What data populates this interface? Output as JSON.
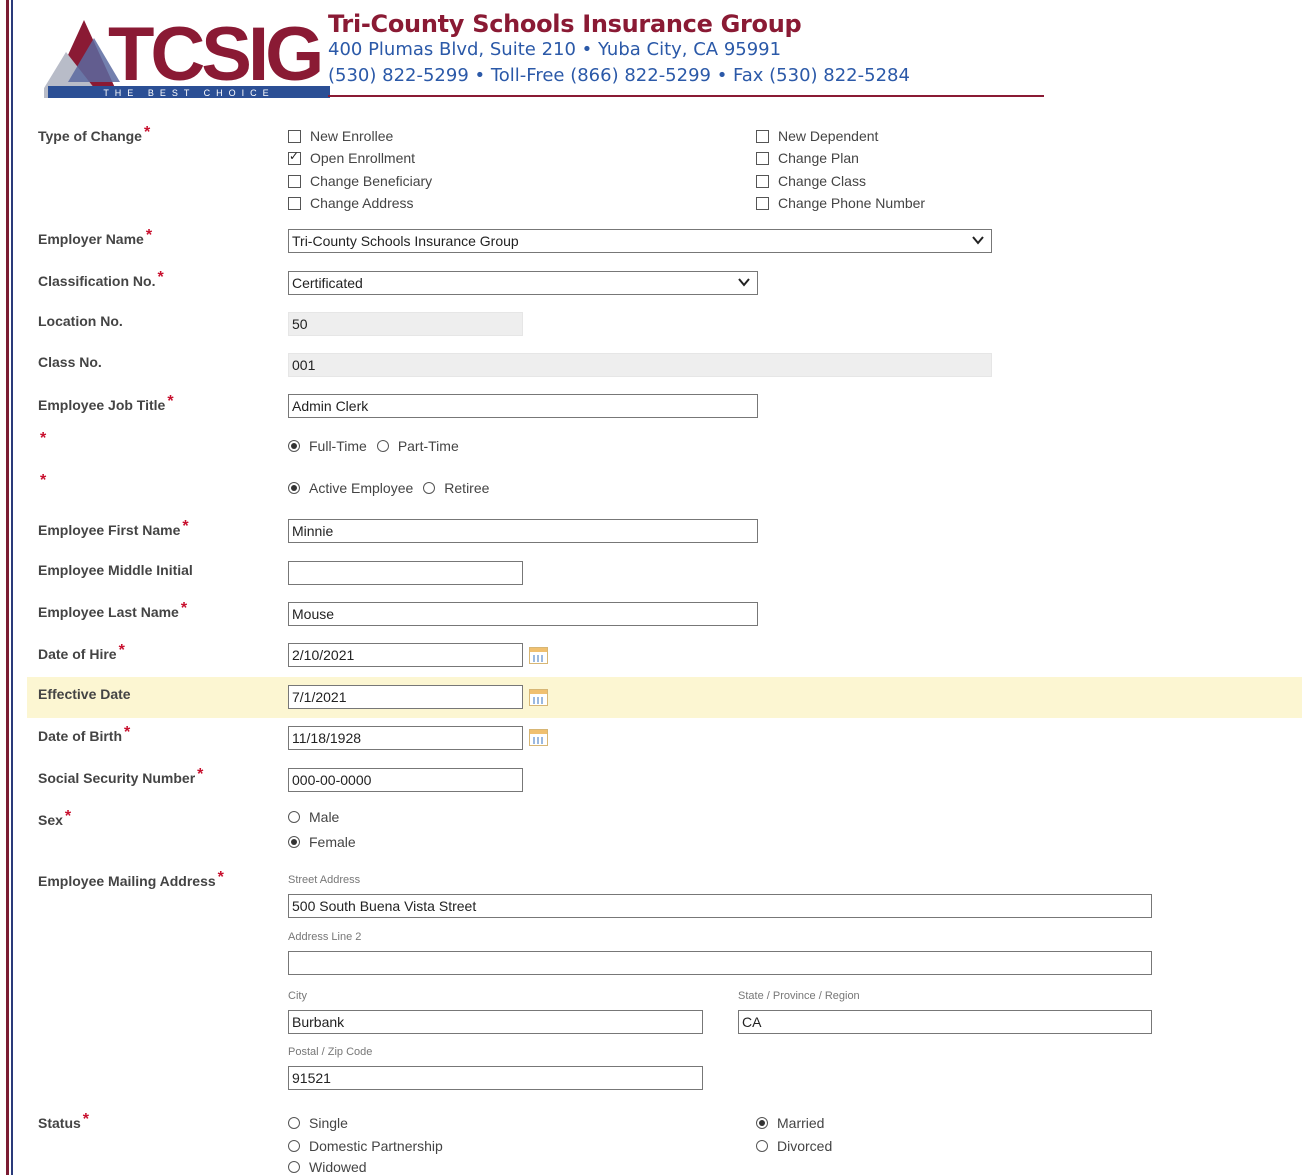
{
  "header": {
    "logo_text": "TCSIG",
    "logo_tagline": "THE BEST CHOICE",
    "org_name": "Tri-County Schools Insurance Group",
    "address": "400 Plumas Blvd, Suite 210  •  Yuba City, CA 95991",
    "phones": "(530) 822-5299  •  Toll-Free (866) 822-5299  •  Fax (530) 822-5284"
  },
  "required_mark": "*",
  "type_of_change": {
    "label": "Type of Change",
    "options": [
      {
        "label": "New Enrollee",
        "checked": false
      },
      {
        "label": "Open Enrollment",
        "checked": true
      },
      {
        "label": "Change Beneficiary",
        "checked": false
      },
      {
        "label": "Change Address",
        "checked": false
      },
      {
        "label": "New Dependent",
        "checked": false
      },
      {
        "label": "Change Plan",
        "checked": false
      },
      {
        "label": "Change Class",
        "checked": false
      },
      {
        "label": "Change Phone Number",
        "checked": false
      }
    ]
  },
  "employer_name": {
    "label": "Employer Name",
    "value": "Tri-County Schools Insurance Group"
  },
  "classification": {
    "label": "Classification No.",
    "value": "Certificated"
  },
  "location": {
    "label": "Location No.",
    "value": "50"
  },
  "class_no": {
    "label": "Class No.",
    "value": "001"
  },
  "job_title": {
    "label": "Employee Job Title",
    "value": "Admin Clerk"
  },
  "work_type": {
    "options": [
      {
        "label": "Full-Time",
        "checked": true
      },
      {
        "label": "Part-Time",
        "checked": false
      }
    ]
  },
  "employee_type": {
    "options": [
      {
        "label": "Active Employee",
        "checked": true
      },
      {
        "label": "Retiree",
        "checked": false
      }
    ]
  },
  "first_name": {
    "label": "Employee First Name",
    "value": "Minnie"
  },
  "middle_initial": {
    "label": "Employee Middle Initial",
    "value": ""
  },
  "last_name": {
    "label": "Employee Last Name",
    "value": "Mouse"
  },
  "date_of_hire": {
    "label": "Date of Hire",
    "value": "2/10/2021"
  },
  "effective_date": {
    "label": "Effective Date",
    "value": "7/1/2021"
  },
  "date_of_birth": {
    "label": "Date of Birth",
    "value": "11/18/1928"
  },
  "ssn": {
    "label": "Social Security Number",
    "value": "000-00-0000"
  },
  "sex": {
    "label": "Sex",
    "options": [
      {
        "label": "Male",
        "checked": false
      },
      {
        "label": "Female",
        "checked": true
      }
    ]
  },
  "mailing_address": {
    "label": "Employee Mailing Address",
    "street_label": "Street Address",
    "street": "500 South Buena Vista Street",
    "line2_label": "Address Line 2",
    "line2": "",
    "city_label": "City",
    "city": "Burbank",
    "state_label": "State / Province / Region",
    "state": "CA",
    "zip_label": "Postal / Zip Code",
    "zip": "91521"
  },
  "status": {
    "label": "Status",
    "options": [
      {
        "label": "Single",
        "checked": false
      },
      {
        "label": "Domestic Partnership",
        "checked": false
      },
      {
        "label": "Widowed",
        "checked": false
      },
      {
        "label": "Married",
        "checked": true
      },
      {
        "label": "Divorced",
        "checked": false
      }
    ]
  },
  "colors": {
    "brand_maroon": "#8a1a34",
    "brand_blue": "#2b59a8",
    "required": "#c8102e",
    "highlight": "#fcf6d2"
  }
}
